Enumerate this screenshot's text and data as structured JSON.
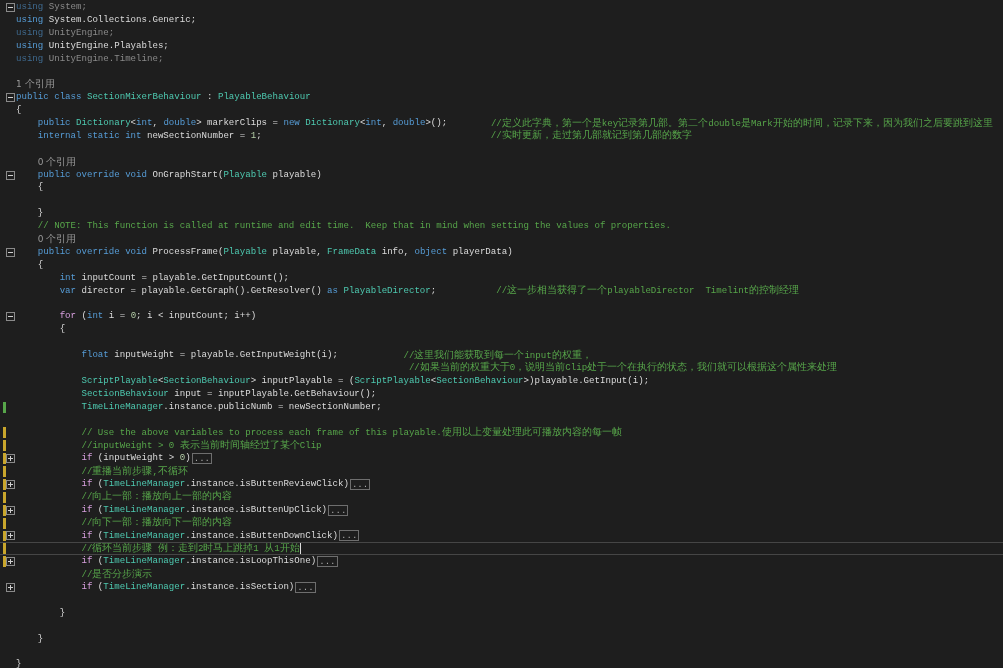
{
  "editor": {
    "lines": [
      {
        "collapsed": false,
        "current": false,
        "tokens": [
          {
            "kind": "dim_keyword",
            "text": "using"
          },
          {
            "kind": "dim",
            "text": " System;"
          }
        ]
      },
      {
        "current": false,
        "tokens": [
          {
            "kind": "keyword",
            "text": "using"
          },
          {
            "kind": "plain",
            "text": " System.Collections.Generic;"
          }
        ]
      },
      {
        "current": false,
        "tokens": [
          {
            "kind": "dim_keyword",
            "text": "using"
          },
          {
            "kind": "dim",
            "text": " UnityEngine;"
          }
        ]
      },
      {
        "current": false,
        "tokens": [
          {
            "kind": "keyword",
            "text": "using"
          },
          {
            "kind": "plain",
            "text": " UnityEngine.Playables;"
          }
        ]
      },
      {
        "current": false,
        "tokens": [
          {
            "kind": "dim_keyword",
            "text": "using"
          },
          {
            "kind": "dim",
            "text": " UnityEngine.Timeline;"
          }
        ]
      },
      {
        "current": false
      },
      {
        "current": false,
        "lens": "1 个引用"
      },
      {
        "collapsed": false,
        "current": false,
        "tokens": [
          {
            "kind": "keyword",
            "text": "public class "
          },
          {
            "kind": "type",
            "text": "SectionMixerBehaviour"
          },
          {
            "kind": "plain",
            "text": " : "
          },
          {
            "kind": "type",
            "text": "PlayableBehaviour"
          }
        ]
      },
      {
        "current": false,
        "tokens": [
          {
            "kind": "plain",
            "text": "{"
          }
        ],
        "children": [
          {
            "current": false,
            "tokens": [
              {
                "kind": "keyword",
                "text": "public "
              },
              {
                "kind": "type",
                "text": "Dictionary"
              },
              {
                "kind": "plain",
                "text": "<"
              },
              {
                "kind": "keyword",
                "text": "int"
              },
              {
                "kind": "plain",
                "text": ", "
              },
              {
                "kind": "keyword",
                "text": "double"
              },
              {
                "kind": "plain",
                "text": "> markerClips = "
              },
              {
                "kind": "keyword",
                "text": "new "
              },
              {
                "kind": "type",
                "text": "Dictionary"
              },
              {
                "kind": "plain",
                "text": "<"
              },
              {
                "kind": "keyword",
                "text": "int"
              },
              {
                "kind": "plain",
                "text": ", "
              },
              {
                "kind": "keyword",
                "text": "double"
              },
              {
                "kind": "plain",
                "text": ">();        "
              }
            ],
            "comment": "//定义此字典，第一个是key记录第几部。第二个double是Mark开始的时间，记录下来，因为我们之后要跳到这里"
          },
          {
            "current": false,
            "tokens": [
              {
                "kind": "keyword",
                "text": "internal static int "
              },
              {
                "kind": "plain",
                "text": "newSectionNumber = "
              },
              {
                "kind": "number",
                "text": "1"
              },
              {
                "kind": "plain",
                "text": ";                                          "
              }
            ],
            "comment": "//实时更新，走过第几部就记到第几部的数字"
          },
          {
            "current": false
          },
          {
            "current": false,
            "lens": "0 个引用"
          },
          {
            "collapsed": false,
            "current": false,
            "tokens": [
              {
                "kind": "keyword",
                "text": "public override void "
              },
              {
                "kind": "plain",
                "text": "OnGraphStart("
              },
              {
                "kind": "type",
                "text": "Playable"
              },
              {
                "kind": "plain",
                "text": " playable)"
              }
            ]
          },
          {
            "current": false,
            "tokens": [
              {
                "kind": "plain",
                "text": "{"
              }
            ],
            "children": [
              {
                "current": false
              }
            ]
          },
          {
            "current": false,
            "tokens": [
              {
                "kind": "plain",
                "text": "}"
              }
            ]
          },
          {
            "current": false,
            "comment": "// NOTE: This function is called at runtime and edit time.  Keep that in mind when setting the values of properties."
          },
          {
            "current": false,
            "lens": "0 个引用"
          },
          {
            "collapsed": false,
            "current": false,
            "tokens": [
              {
                "kind": "keyword",
                "text": "public override void "
              },
              {
                "kind": "plain",
                "text": "ProcessFrame("
              },
              {
                "kind": "type",
                "text": "Playable"
              },
              {
                "kind": "plain",
                "text": " playable, "
              },
              {
                "kind": "type",
                "text": "FrameData"
              },
              {
                "kind": "plain",
                "text": " info, "
              },
              {
                "kind": "keyword",
                "text": "object"
              },
              {
                "kind": "plain",
                "text": " playerData)"
              }
            ]
          },
          {
            "current": false,
            "tokens": [
              {
                "kind": "plain",
                "text": "{"
              }
            ],
            "children": [
              {
                "current": false,
                "tokens": [
                  {
                    "kind": "keyword",
                    "text": "int"
                  },
                  {
                    "kind": "plain",
                    "text": " inputCount = playable.GetInputCount();"
                  }
                ]
              },
              {
                "current": false,
                "tokens": [
                  {
                    "kind": "keyword",
                    "text": "var"
                  },
                  {
                    "kind": "plain",
                    "text": " director = playable.GetGraph().GetResolver() "
                  },
                  {
                    "kind": "keyword",
                    "text": "as "
                  },
                  {
                    "kind": "type",
                    "text": "PlayableDirector"
                  },
                  {
                    "kind": "plain",
                    "text": ";           "
                  }
                ],
                "comment": "//这一步相当获得了一个playableDirector  Timelint的控制经理"
              },
              {
                "current": false
              },
              {
                "collapsed": false,
                "current": false,
                "tokens": [
                  {
                    "kind": "control",
                    "text": "for"
                  },
                  {
                    "kind": "plain",
                    "text": " ("
                  },
                  {
                    "kind": "keyword",
                    "text": "int"
                  },
                  {
                    "kind": "plain",
                    "text": " i = "
                  },
                  {
                    "kind": "number",
                    "text": "0"
                  },
                  {
                    "kind": "plain",
                    "text": "; i < inputCount; i++)"
                  }
                ]
              },
              {
                "current": false,
                "tokens": [
                  {
                    "kind": "plain",
                    "text": "{"
                  }
                ],
                "children": [
                  {
                    "current": false
                  },
                  {
                    "current": false,
                    "tokens": [
                      {
                        "kind": "keyword",
                        "text": "float"
                      },
                      {
                        "kind": "plain",
                        "text": " inputWeight = playable.GetInputWeight(i);            "
                      }
                    ],
                    "comment": "//这里我们能获取到每一个input的权重，"
                  },
                  {
                    "current": false,
                    "comment": "                                                            //如果当前的权重大于0，说明当前Clip处于一个在执行的状态，我们就可以根据这个属性来处理"
                  },
                  {
                    "current": false,
                    "tokens": [
                      {
                        "kind": "type",
                        "text": "ScriptPlayable"
                      },
                      {
                        "kind": "plain",
                        "text": "<"
                      },
                      {
                        "kind": "type",
                        "text": "SectionBehaviour"
                      },
                      {
                        "kind": "plain",
                        "text": "> inputPlayable = ("
                      },
                      {
                        "kind": "type",
                        "text": "ScriptPlayable"
                      },
                      {
                        "kind": "plain",
                        "text": "<"
                      },
                      {
                        "kind": "type",
                        "text": "SectionBehaviour"
                      },
                      {
                        "kind": "plain",
                        "text": ">)playable.GetInput(i);"
                      }
                    ]
                  },
                  {
                    "current": false,
                    "tokens": [
                      {
                        "kind": "type",
                        "text": "SectionBehaviour"
                      },
                      {
                        "kind": "plain",
                        "text": " input = inputPlayable.GetBehaviour();"
                      }
                    ]
                  },
                  {
                    "unsaved_change": false,
                    "current": false,
                    "tokens": [
                      {
                        "kind": "type",
                        "text": "TimeLineManager"
                      },
                      {
                        "kind": "plain",
                        "text": ".instance.publicNumb = newSectionNumber;"
                      }
                    ]
                  },
                  {
                    "current": false
                  },
                  {
                    "unsaved_change": true,
                    "current": false,
                    "comment": "// Use the above variables to process each frame of this playable.使用以上变量处理此可播放内容的每一帧"
                  },
                  {
                    "unsaved_change": true,
                    "current": false,
                    "comment": "//inputWeight > 0 表示当前时间轴经过了某个Clip"
                  },
                  {
                    "unsaved_change": true,
                    "collapsed": true,
                    "current": false,
                    "tokens": [
                      {
                        "kind": "control",
                        "text": "if"
                      },
                      {
                        "kind": "plain",
                        "text": " (inputWeight > "
                      },
                      {
                        "kind": "number",
                        "text": "0"
                      },
                      {
                        "kind": "plain",
                        "text": ")"
                      }
                    ],
                    "collapsed_text": "..."
                  },
                  {
                    "unsaved_change": true,
                    "current": false,
                    "comment": "//重播当前步骤,不循环"
                  },
                  {
                    "unsaved_change": true,
                    "collapsed": true,
                    "current": false,
                    "tokens": [
                      {
                        "kind": "control",
                        "text": "if"
                      },
                      {
                        "kind": "plain",
                        "text": " ("
                      },
                      {
                        "kind": "type",
                        "text": "TimeLineManager"
                      },
                      {
                        "kind": "plain",
                        "text": ".instance.isButtenReviewClick)"
                      }
                    ],
                    "collapsed_text": "..."
                  },
                  {
                    "unsaved_change": true,
                    "current": false,
                    "comment": "//向上一部：播放向上一部的内容"
                  },
                  {
                    "unsaved_change": true,
                    "collapsed": true,
                    "current": false,
                    "tokens": [
                      {
                        "kind": "control",
                        "text": "if"
                      },
                      {
                        "kind": "plain",
                        "text": " ("
                      },
                      {
                        "kind": "type",
                        "text": "TimeLineManager"
                      },
                      {
                        "kind": "plain",
                        "text": ".instance.isButtenUpClick)"
                      }
                    ],
                    "collapsed_text": "..."
                  },
                  {
                    "unsaved_change": true,
                    "current": false,
                    "comment": "//向下一部：播放向下一部的内容"
                  },
                  {
                    "unsaved_change": true,
                    "collapsed": true,
                    "current": false,
                    "tokens": [
                      {
                        "kind": "control",
                        "text": "if"
                      },
                      {
                        "kind": "plain",
                        "text": " ("
                      },
                      {
                        "kind": "type",
                        "text": "TimeLineManager"
                      },
                      {
                        "kind": "plain",
                        "text": ".instance.isButtenDownClick)"
                      }
                    ],
                    "collapsed_text": "..."
                  },
                  {
                    "unsaved_change": true,
                    "current": true,
                    "comment": "//循环当前步骤 例：走到2时马上跳掉1 从1开始"
                  },
                  {
                    "unsaved_change": true,
                    "collapsed": true,
                    "current": false,
                    "tokens": [
                      {
                        "kind": "control",
                        "text": "if"
                      },
                      {
                        "kind": "plain",
                        "text": " ("
                      },
                      {
                        "kind": "type",
                        "text": "TimeLineManager"
                      },
                      {
                        "kind": "plain",
                        "text": ".instance.isLoopThisOne)"
                      }
                    ],
                    "collapsed_text": "..."
                  },
                  {
                    "current": false,
                    "comment": "//是否分步演示"
                  },
                  {
                    "collapsed": true,
                    "current": false,
                    "tokens": [
                      {
                        "kind": "control",
                        "text": "if"
                      },
                      {
                        "kind": "plain",
                        "text": " ("
                      },
                      {
                        "kind": "type",
                        "text": "TimeLineManager"
                      },
                      {
                        "kind": "plain",
                        "text": ".instance.isSection)"
                      }
                    ],
                    "collapsed_text": "..."
                  },
                  {
                    "current": false
                  }
                ]
              },
              {
                "current": false,
                "tokens": [
                  {
                    "kind": "plain",
                    "text": "}"
                  }
                ]
              },
              {
                "current": false
              }
            ]
          },
          {
            "current": false,
            "tokens": [
              {
                "kind": "plain",
                "text": "}"
              }
            ]
          },
          {
            "current": false
          }
        ]
      },
      {
        "current": false,
        "tokens": [
          {
            "kind": "plain",
            "text": "}"
          }
        ]
      }
    ]
  }
}
